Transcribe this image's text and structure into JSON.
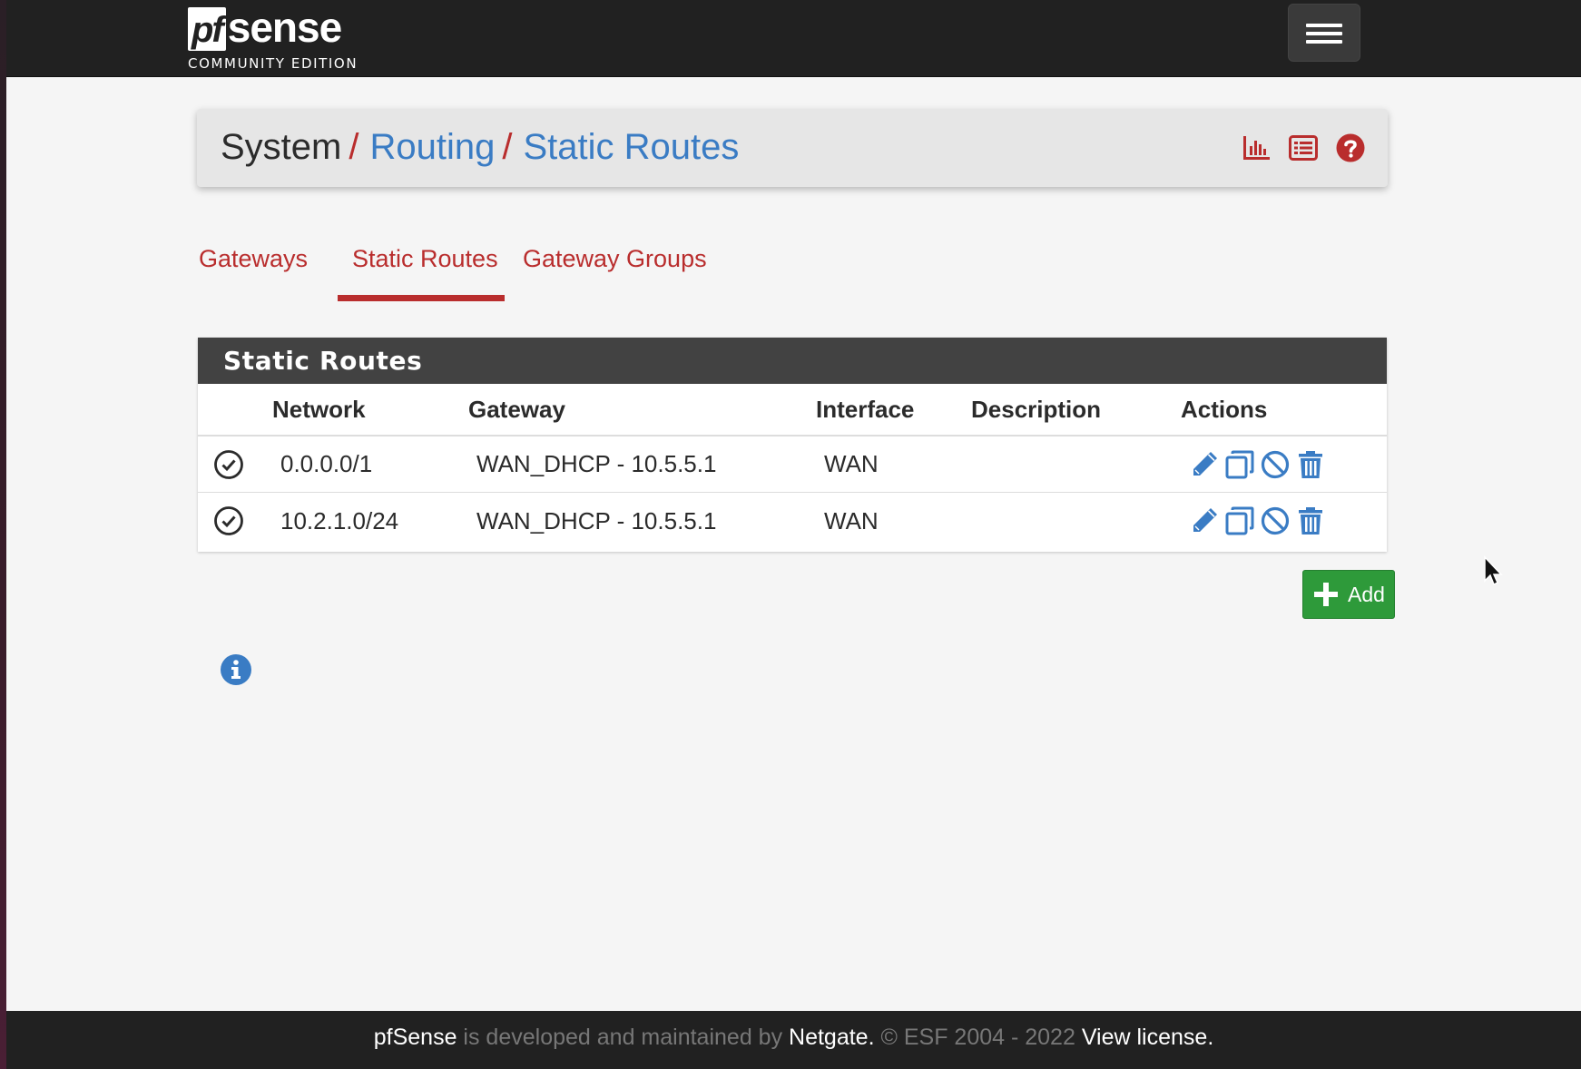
{
  "logo": {
    "pf": "pf",
    "sense": "sense",
    "edition": "COMMUNITY EDITION"
  },
  "breadcrumb": {
    "system": "System",
    "routing": "Routing",
    "current": "Static Routes",
    "separator": "/"
  },
  "header_icons": [
    "chart-icon",
    "list-icon",
    "help-icon"
  ],
  "tabs": [
    {
      "label": "Gateways",
      "active": false
    },
    {
      "label": "Static Routes",
      "active": true
    },
    {
      "label": "Gateway Groups",
      "active": false
    }
  ],
  "panel": {
    "title": "Static Routes",
    "columns": [
      "Network",
      "Gateway",
      "Interface",
      "Description",
      "Actions"
    ],
    "rows": [
      {
        "network": "0.0.0.0/1",
        "gateway": "WAN_DHCP - 10.5.5.1",
        "interface": "WAN",
        "description": ""
      },
      {
        "network": "10.2.1.0/24",
        "gateway": "WAN_DHCP - 10.5.5.1",
        "interface": "WAN",
        "description": ""
      }
    ]
  },
  "add_button": {
    "label": "Add"
  },
  "footer": {
    "brand": "pfSense",
    "text1": " is developed and maintained by ",
    "company": "Netgate.",
    "text2": " © ESF 2004 - 2022 ",
    "license": "View license."
  },
  "colors": {
    "accent_red": "#b92d2d",
    "link_blue": "#3a7cc4",
    "add_green": "#2e9a3a",
    "navbar": "#212121"
  }
}
